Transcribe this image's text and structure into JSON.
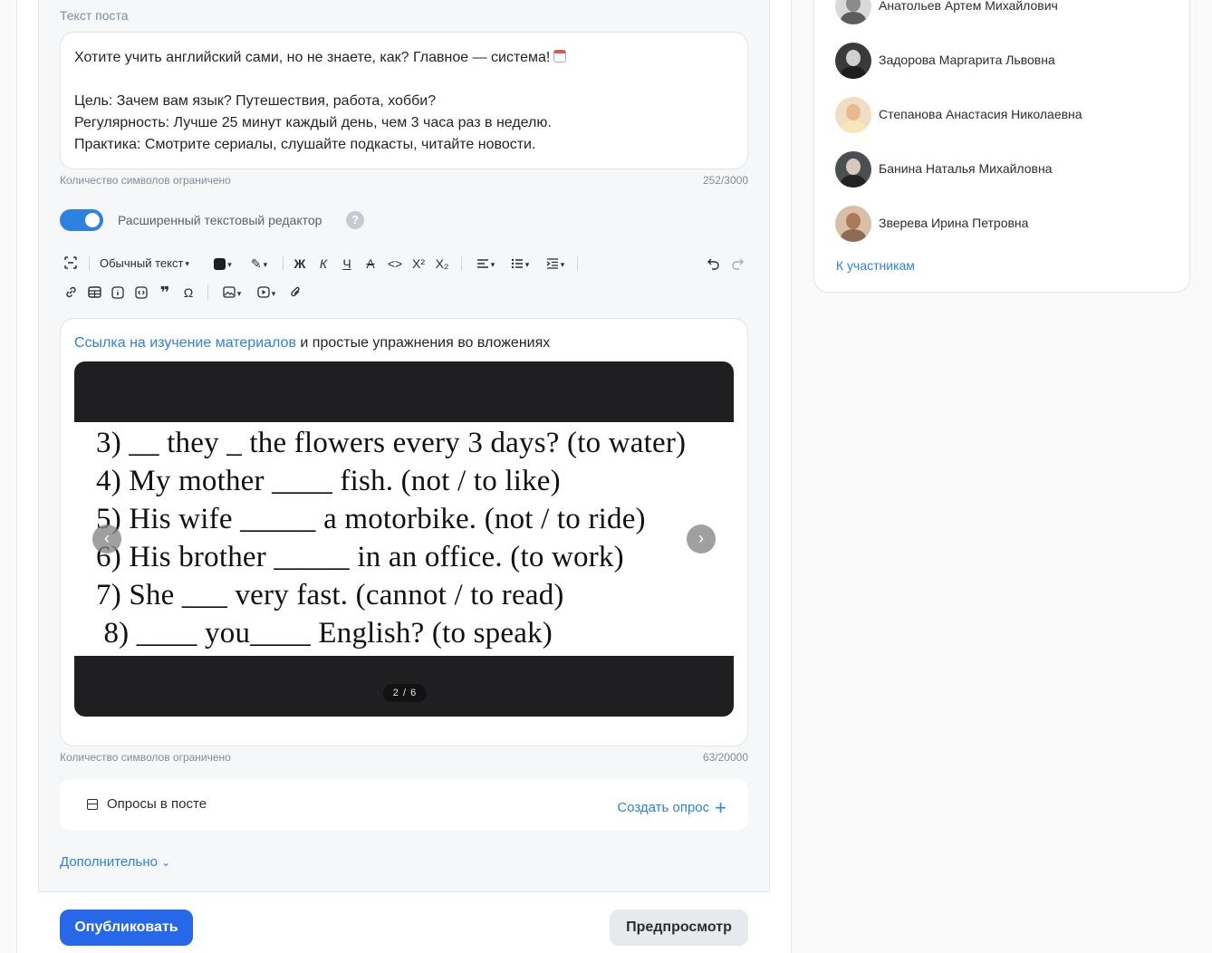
{
  "post": {
    "label": "Текст поста",
    "lines": [
      "Хотите учить английский сами, но не знаете, как? Главное — система!",
      "",
      "Цель: Зачем вам язык? Путешествия, работа, хобби?",
      "Регулярность: Лучше 25 минут каждый день, чем 3 часа раз в неделю.",
      "Практика: Смотрите сериалы, слушайте подкасты, читайте новости."
    ],
    "hint": "Количество символов ограничено",
    "counter": "252/3000"
  },
  "rich_editor": {
    "toggle_label": "Расширенный текстовый редактор",
    "toggle_on": true,
    "help": "?"
  },
  "toolbar": {
    "text_style": "Обычный текст",
    "bold": "Ж",
    "italic": "К",
    "underline": "Ч",
    "strike": "A",
    "code": "<>",
    "superscript": "X²",
    "subscript": "X₂",
    "quote": "❞",
    "omega": "Ω"
  },
  "content": {
    "link_text": "Ссылка на изучение материалов",
    "rest_text": " и простые упражнения во вложениях",
    "hint": "Количество символов ограничено",
    "counter": "63/20000"
  },
  "carousel": {
    "slide_lines": [
      "3) __ they _ the flowers every 3 days? (to water)",
      "4) My mother ____ fish. (not / to like)",
      "5) His wife _____ a motorbike. (not / to ride)",
      "6) His brother _____ in an office. (to work)",
      "7) She ___ very fast. (cannot / to read)",
      " 8) ____ you____ English? (to speak)"
    ],
    "pager": "2 / 6",
    "prev": "‹",
    "next": "›"
  },
  "polls": {
    "label": "Опросы в посте",
    "create": "Создать опрос",
    "create_icon": "+"
  },
  "more": {
    "label": "Дополнительно",
    "icon": "⌄"
  },
  "actions": {
    "publish": "Опубликовать",
    "preview": "Предпросмотр"
  },
  "members": {
    "list": [
      {
        "name": "Анатольев Артем Михайлович"
      },
      {
        "name": "Задорова Маргарита Львовна"
      },
      {
        "name": "Степанова Анастасия Николаевна"
      },
      {
        "name": "Банина Наталья Михайловна"
      },
      {
        "name": "Зверева Ирина Петровна"
      }
    ],
    "link": "К участникам"
  },
  "colors": {
    "accent": "#2d81e0",
    "publish": "#2668e8"
  }
}
